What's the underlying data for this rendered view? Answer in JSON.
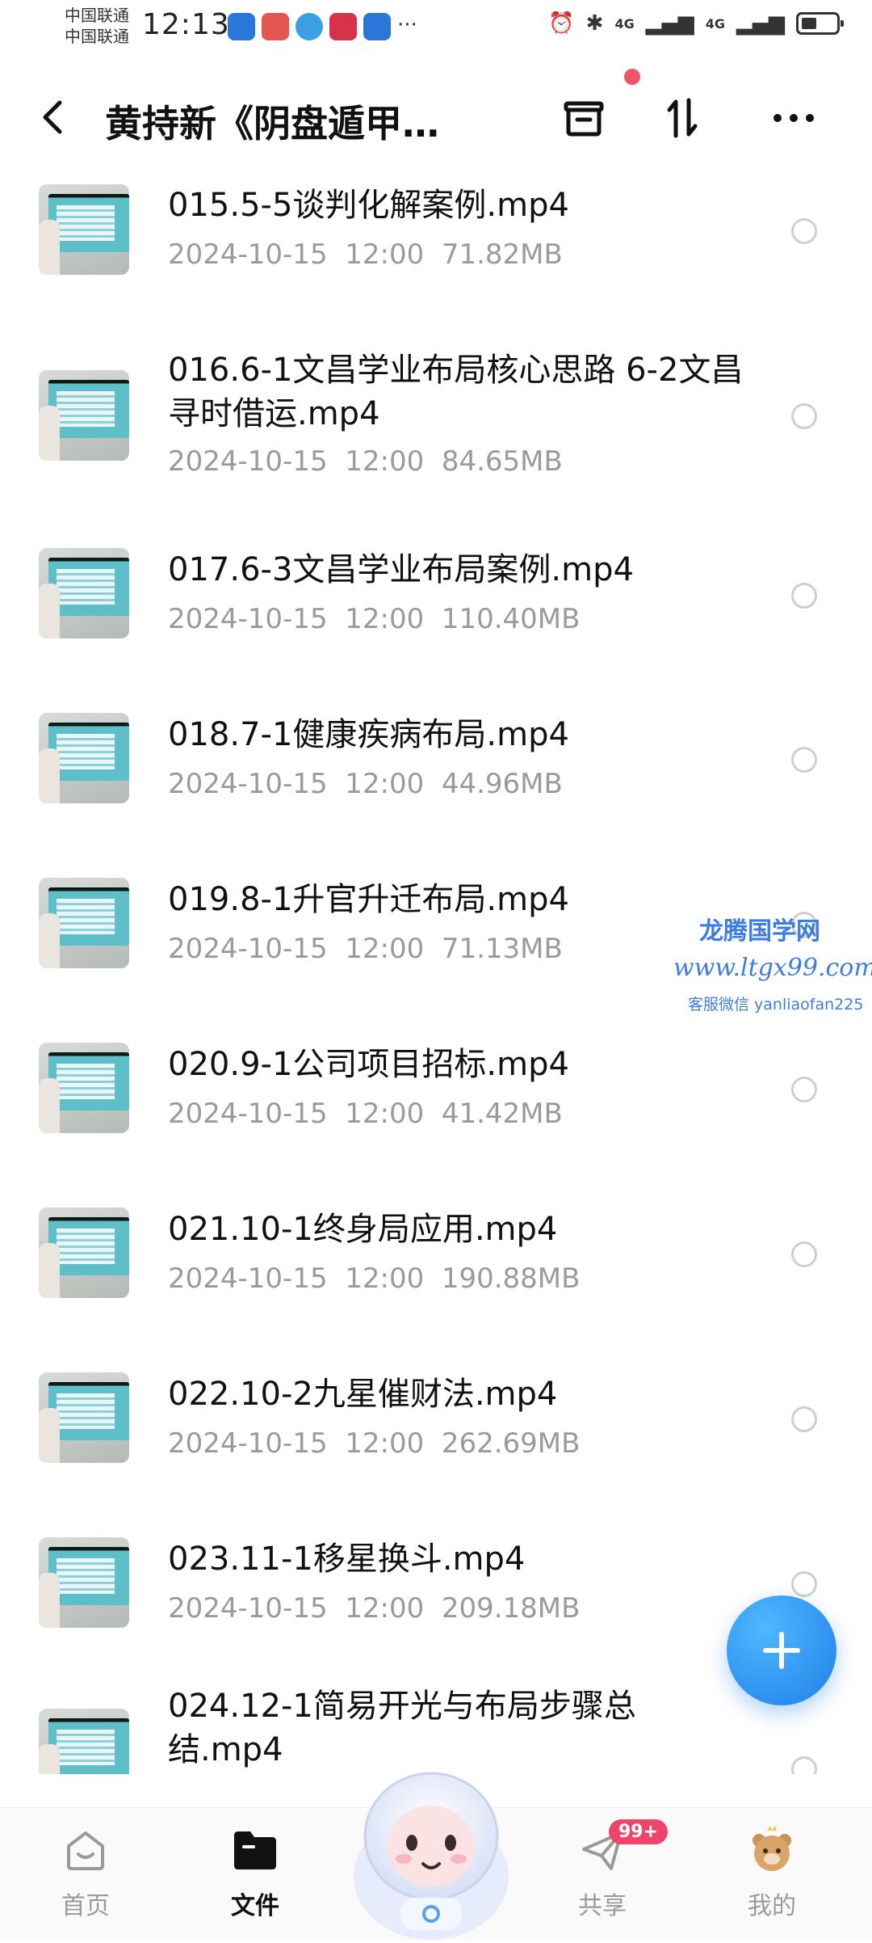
{
  "status_bar": {
    "carrier_1": "中国联通",
    "carrier_2": "中国联通",
    "time": "12:13",
    "signal_label": "4G",
    "overflow": "···"
  },
  "header": {
    "title": "黄持新《阴盘遁甲…"
  },
  "files": [
    {
      "name": "015.5-5谈判化解案例.mp4",
      "date": "2024-10-15",
      "time": "12:00",
      "size": "71.82MB"
    },
    {
      "name": "016.6-1文昌学业布局核心思路 6-2文昌寻时借运.mp4",
      "date": "2024-10-15",
      "time": "12:00",
      "size": "84.65MB"
    },
    {
      "name": "017.6-3文昌学业布局案例.mp4",
      "date": "2024-10-15",
      "time": "12:00",
      "size": "110.40MB"
    },
    {
      "name": "018.7-1健康疾病布局.mp4",
      "date": "2024-10-15",
      "time": "12:00",
      "size": "44.96MB"
    },
    {
      "name": "019.8-1升官升迁布局.mp4",
      "date": "2024-10-15",
      "time": "12:00",
      "size": "71.13MB"
    },
    {
      "name": "020.9-1公司项目招标.mp4",
      "date": "2024-10-15",
      "time": "12:00",
      "size": "41.42MB"
    },
    {
      "name": "021.10-1终身局应用.mp4",
      "date": "2024-10-15",
      "time": "12:00",
      "size": "190.88MB"
    },
    {
      "name": "022.10-2九星催财法.mp4",
      "date": "2024-10-15",
      "time": "12:00",
      "size": "262.69MB"
    },
    {
      "name": "023.11-1移星换斗.mp4",
      "date": "2024-10-15",
      "time": "12:00",
      "size": "209.18MB"
    },
    {
      "name": "024.12-1简易开光与布局步骤总结.mp4",
      "date": "",
      "time": "",
      "size": ""
    }
  ],
  "watermark": {
    "line1": "龙腾国学网",
    "line2": "www.ltgx99.com",
    "line3": "客服微信 yanliaofan225"
  },
  "bottom_nav": {
    "home": "首页",
    "files": "文件",
    "share": "共享",
    "share_badge": "99+",
    "mine": "我的"
  },
  "colors": {
    "accent": "#1f7fe8",
    "badge": "#f0456a",
    "meta_text": "#9a9a9a"
  }
}
